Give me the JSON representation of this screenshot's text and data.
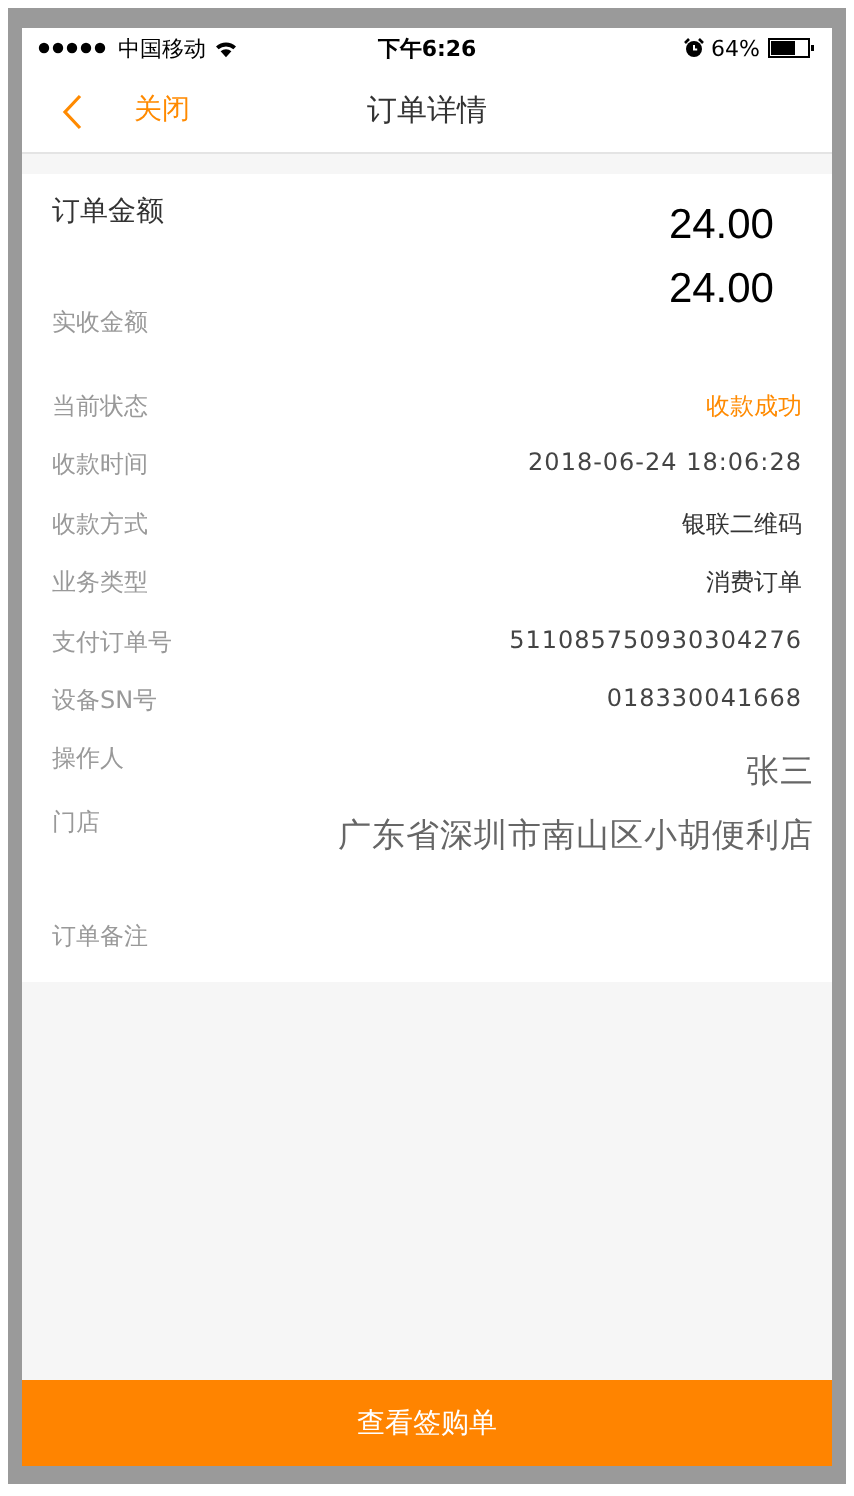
{
  "status_bar": {
    "carrier": "中国移动",
    "time": "下午6:26",
    "battery": "64%"
  },
  "nav": {
    "close": "关闭",
    "title": "订单详情"
  },
  "amounts": [
    {
      "label": "订单金额",
      "value": "24.00",
      "kind": "main"
    },
    {
      "label": "实收金额",
      "value": "24.00",
      "kind": "sub"
    }
  ],
  "details": [
    {
      "label": "当前状态",
      "value": "收款成功",
      "kind": "highlight"
    },
    {
      "label": "收款时间",
      "value": "2018-06-24 18:06:28",
      "kind": "text"
    },
    {
      "label": "收款方式",
      "value": "银联二维码",
      "kind": "strong"
    },
    {
      "label": "业务类型",
      "value": "消费订单",
      "kind": "strong"
    },
    {
      "label": "支付订单号",
      "value": "511085750930304276",
      "kind": "text"
    },
    {
      "label": "设备SN号",
      "value": "018330041668",
      "kind": "text"
    },
    {
      "label": "操作人",
      "value": "张三",
      "kind": "large"
    },
    {
      "label": "门店",
      "value": "广东省深圳市南山区小胡便利店",
      "kind": "large"
    }
  ],
  "remark": {
    "label": "订单备注"
  },
  "action_button": "查看签购单"
}
